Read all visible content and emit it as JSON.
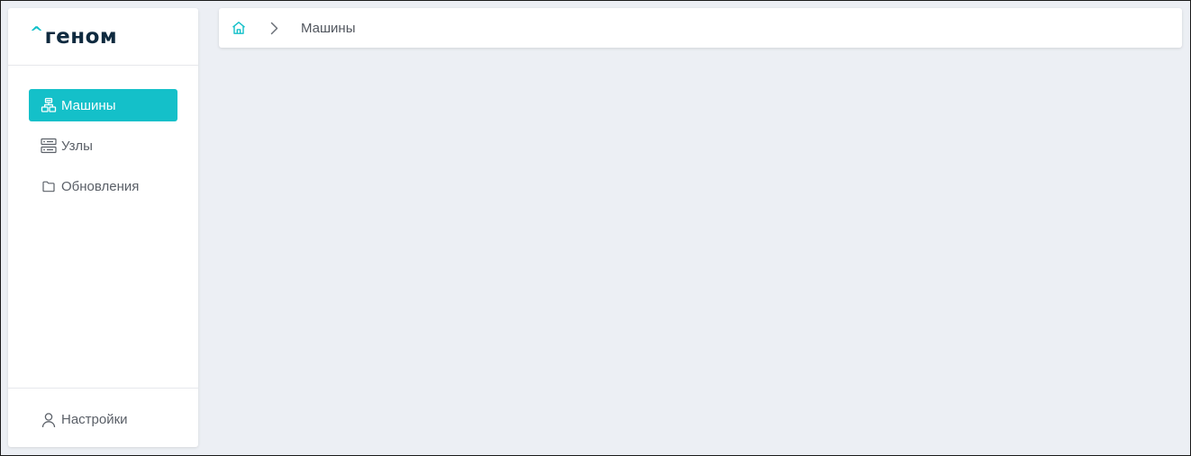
{
  "app": {
    "logo_caret": "^",
    "logo_text": "геном"
  },
  "sidebar": {
    "items": [
      {
        "label": "Машины",
        "icon": "machines-icon",
        "active": true
      },
      {
        "label": "Узлы",
        "icon": "server-icon",
        "active": false
      },
      {
        "label": "Обновления",
        "icon": "folder-icon",
        "active": false
      }
    ],
    "bottom": {
      "label": "Настройки",
      "icon": "user-icon"
    }
  },
  "breadcrumb": {
    "home_icon": "home-icon",
    "separator_icon": "chevron-right-icon",
    "current": "Машины"
  },
  "colors": {
    "accent": "#14c0c9",
    "logo_dark": "#0f2a3f",
    "background": "#eceff4",
    "text": "#5b6068"
  }
}
